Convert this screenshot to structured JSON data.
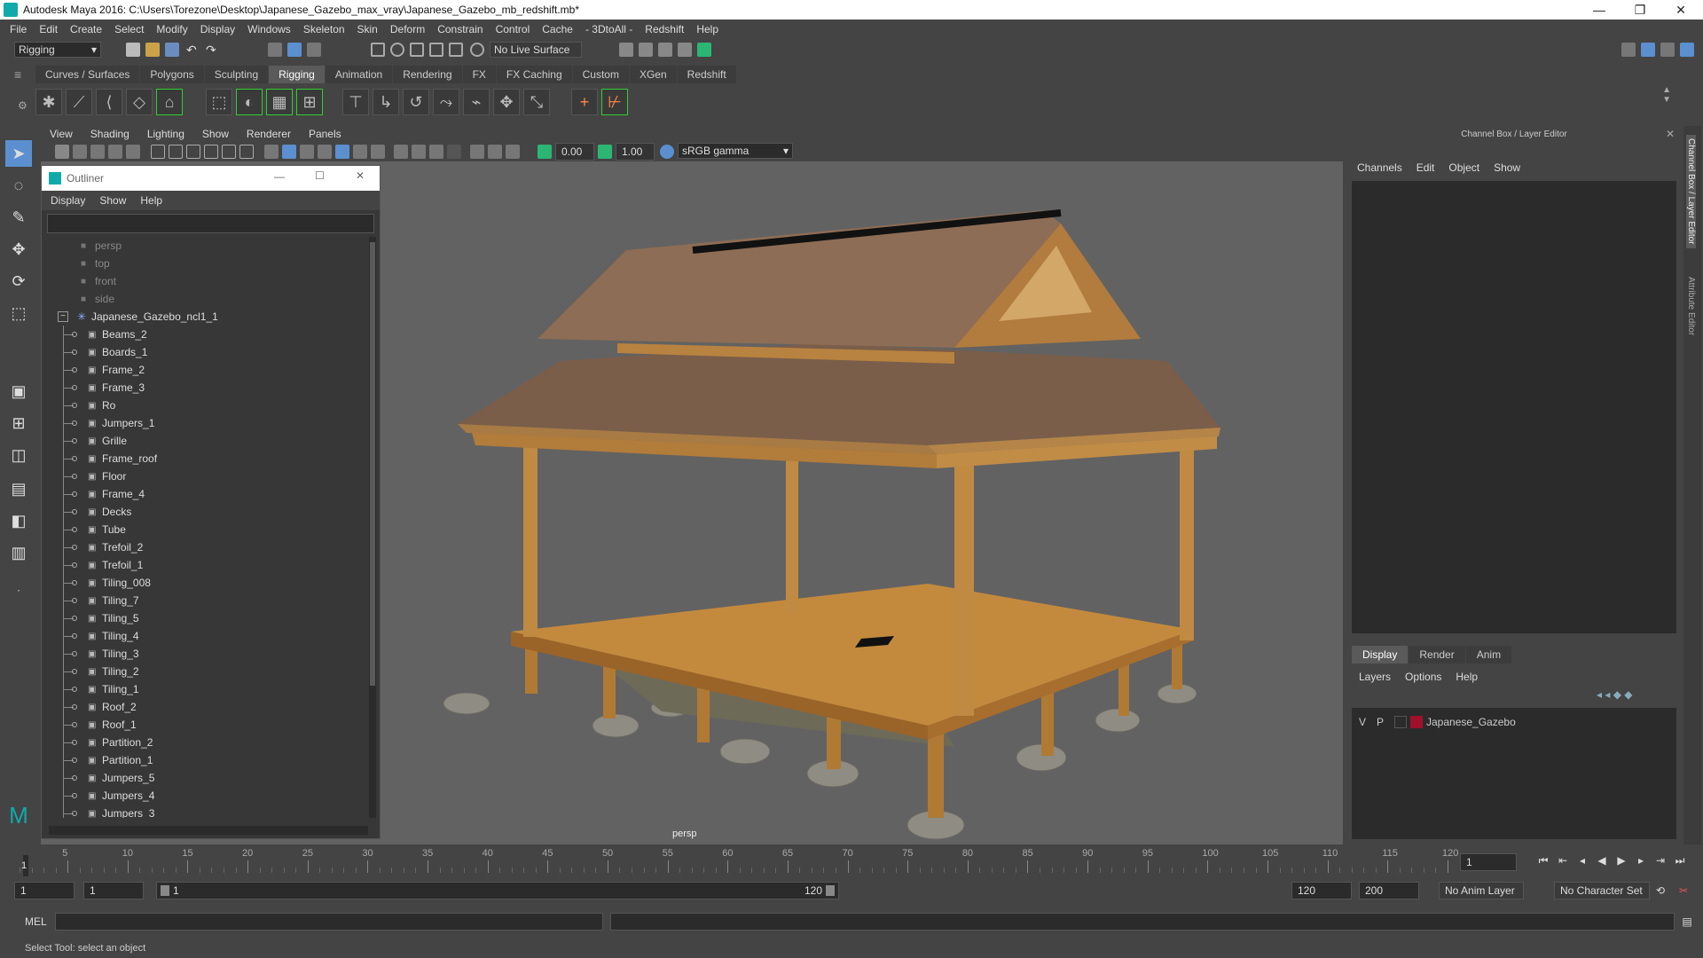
{
  "window": {
    "title": "Autodesk Maya 2016: C:\\Users\\Torezone\\Desktop\\Japanese_Gazebo_max_vray\\Japanese_Gazebo_mb_redshift.mb*",
    "min": "—",
    "max": "❐",
    "close": "✕"
  },
  "menu": [
    "File",
    "Edit",
    "Create",
    "Select",
    "Modify",
    "Display",
    "Windows",
    "Skeleton",
    "Skin",
    "Deform",
    "Constrain",
    "Control",
    "Cache",
    "- 3DtoAll -",
    "Redshift",
    "Help"
  ],
  "status": {
    "mode": "Rigging",
    "live_surface": "No Live Surface"
  },
  "shelf_tabs": [
    "Curves / Surfaces",
    "Polygons",
    "Sculpting",
    "Rigging",
    "Animation",
    "Rendering",
    "FX",
    "FX Caching",
    "Custom",
    "XGen",
    "Redshift"
  ],
  "active_shelf_tab": "Rigging",
  "panel_menu": [
    "View",
    "Shading",
    "Lighting",
    "Show",
    "Renderer",
    "Panels"
  ],
  "viewbar": {
    "exposure": "0.00",
    "gamma": "1.00",
    "color_space": "sRGB gamma"
  },
  "viewport": {
    "camera_label": "persp"
  },
  "outliner": {
    "title": "Outliner",
    "menus": [
      "Display",
      "Show",
      "Help"
    ],
    "cameras": [
      "persp",
      "top",
      "front",
      "side"
    ],
    "root": "Japanese_Gazebo_ncl1_1",
    "children": [
      "Beams_2",
      "Boards_1",
      "Frame_2",
      "Frame_3",
      "Ro",
      "Jumpers_1",
      "Grille",
      "Frame_roof",
      "Floor",
      "Frame_4",
      "Decks",
      "Tube",
      "Trefoil_2",
      "Trefoil_1",
      "Tiling_008",
      "Tiling_7",
      "Tiling_5",
      "Tiling_4",
      "Tiling_3",
      "Tiling_2",
      "Tiling_1",
      "Roof_2",
      "Roof_1",
      "Partition_2",
      "Partition_1",
      "Jumpers_5",
      "Jumpers_4",
      "Jumpers_3"
    ]
  },
  "channel_box": {
    "title": "Channel Box / Layer Editor",
    "menus": [
      "Channels",
      "Edit",
      "Object",
      "Show"
    ],
    "tabs": [
      "Display",
      "Render",
      "Anim"
    ],
    "active_tab": "Display",
    "layer_menus": [
      "Layers",
      "Options",
      "Help"
    ],
    "layer": {
      "v": "V",
      "p": "P",
      "name": "Japanese_Gazebo",
      "color": "#a0102a"
    }
  },
  "side_tabs": [
    "Channel Box / Layer Editor",
    "Attribute Editor"
  ],
  "timeline": {
    "ticks": [
      "5",
      "10",
      "15",
      "20",
      "25",
      "30",
      "35",
      "40",
      "45",
      "50",
      "55",
      "60",
      "65",
      "70",
      "75",
      "80",
      "85",
      "90",
      "95",
      "100",
      "105",
      "110",
      "115",
      "120"
    ],
    "start_label": "1",
    "current_frame": "1"
  },
  "range": {
    "start": "1",
    "playback_start": "1",
    "slider_start": "1",
    "slider_end": "120",
    "end": "120",
    "anim_end": "200",
    "anim_layer": "No Anim Layer",
    "char_set": "No Character Set"
  },
  "command": {
    "label": "MEL"
  },
  "help_line": "Select Tool: select an object"
}
